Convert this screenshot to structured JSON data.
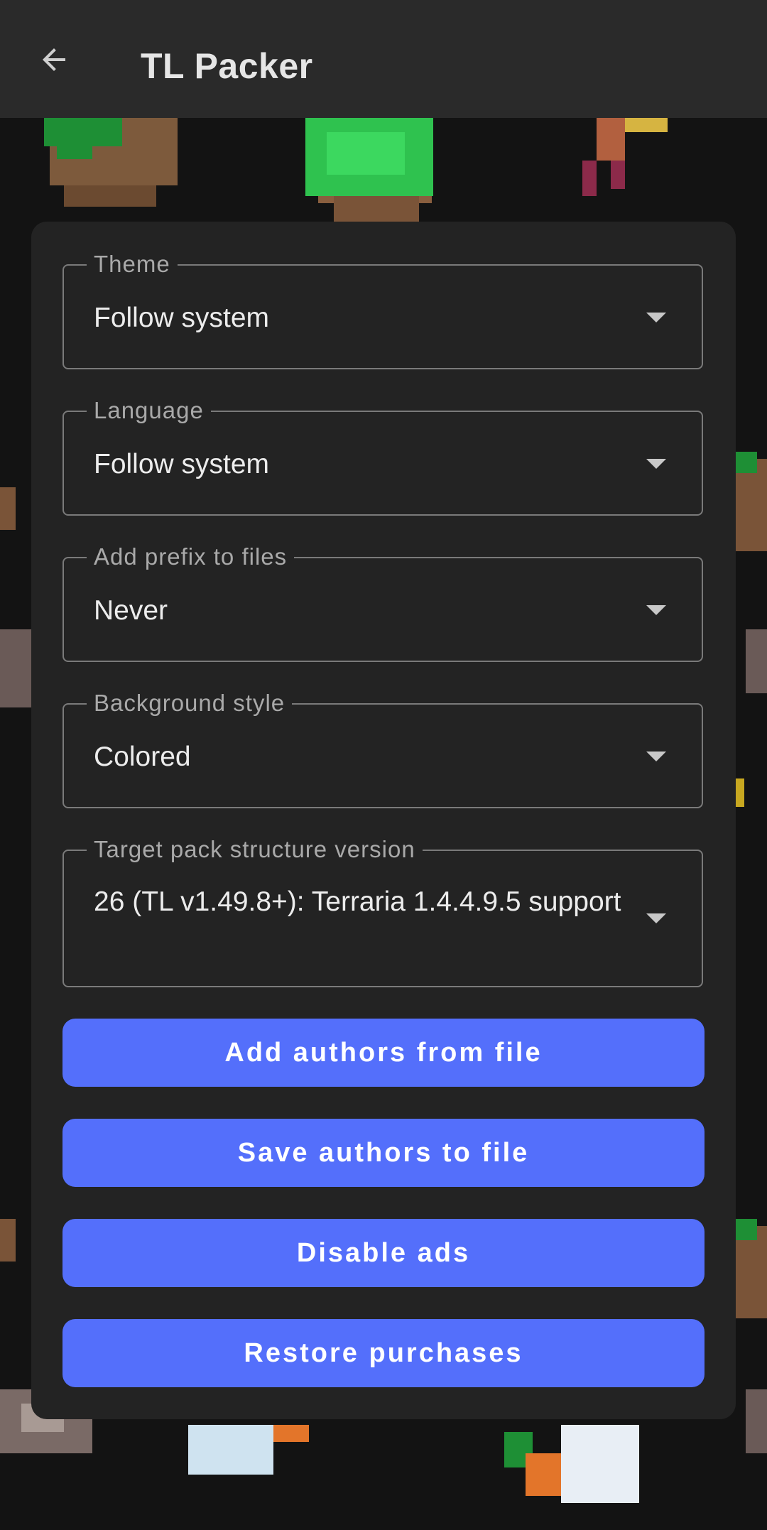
{
  "app_bar": {
    "title": "TL Packer",
    "back_icon": "arrow-back-icon"
  },
  "settings": {
    "theme": {
      "label": "Theme",
      "value": "Follow system"
    },
    "language": {
      "label": "Language",
      "value": "Follow system"
    },
    "prefix": {
      "label": "Add prefix to files",
      "value": "Never"
    },
    "background": {
      "label": "Background style",
      "value": "Colored"
    },
    "structure": {
      "label": "Target pack structure version",
      "value": "26 (TL v1.49.8+): Terraria 1.4.4.9.5 support"
    }
  },
  "buttons": {
    "add_authors": "Add authors from file",
    "save_authors": "Save authors to file",
    "disable_ads": "Disable ads",
    "restore_purchases": "Restore purchases"
  },
  "colors": {
    "accent": "#546ffb",
    "card": "#232323",
    "app_bar": "#2a2a2a",
    "background": "#131313"
  }
}
